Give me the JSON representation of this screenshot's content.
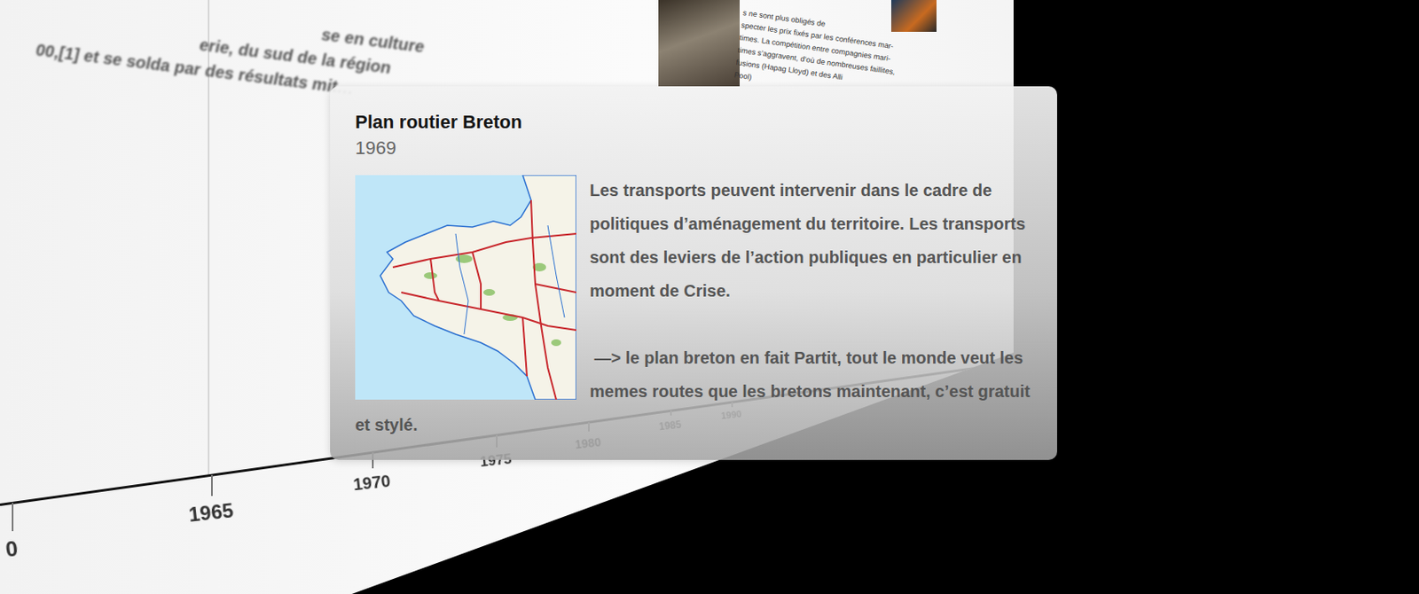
{
  "background_text": [
    "se en culture",
    "erie, du sud de la région",
    "00,[1] et se solda par des résultats mit…"
  ],
  "background_card": {
    "lines": [
      "s ne sont plus obligés de",
      "specter les prix fixés par les conférences mar-",
      "times. La compétition entre compagnies mari-",
      "times s’aggravent, d’où de nombreuses faillites,",
      "fusions (Hapag Lloyd) et des Alli",
      "Pool)"
    ]
  },
  "axis": {
    "ticks": [
      "0",
      "1965",
      "1970",
      "1975",
      "1980",
      "1985",
      "1990"
    ]
  },
  "tooltip": {
    "title": "Plan routier Breton",
    "date": "1969",
    "paragraphs": [
      "Les transports peuvent intervenir dans le cadre de politiques d’aménagement du territoire. Les transports sont des leviers de l’action publiques en particulier en moment de Crise.",
      " —> le plan breton en fait Partit, tout le monde veut les memes routes que les bretons maintenant, c’est gratuit et stylé."
    ]
  }
}
